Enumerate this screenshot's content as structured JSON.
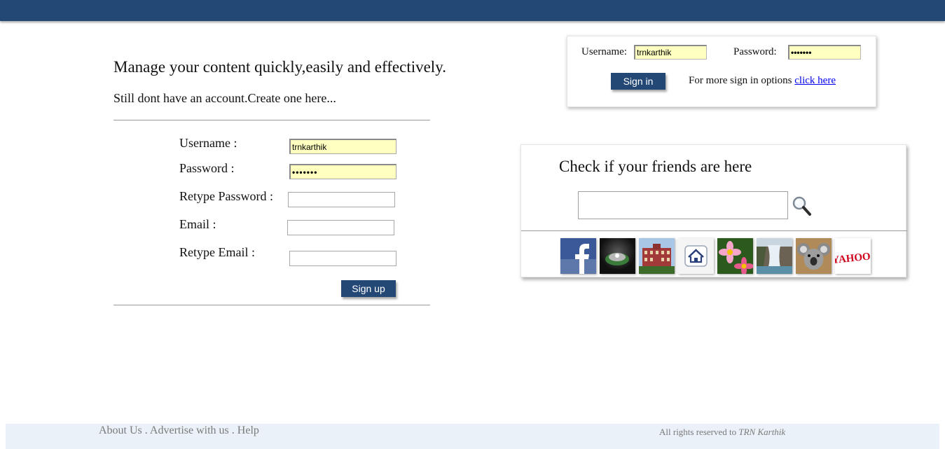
{
  "header": {
    "bar_color": "#244876"
  },
  "signup": {
    "tagline": "Manage your content quickly,easily and effectively.",
    "subline": "Still dont have an account.Create one here...",
    "username_label": "Username :",
    "username_value": "trnkarthik",
    "password_label": "Password :",
    "password_value": "•••••••",
    "retype_password_label": "Retype Password :",
    "email_label": "Email :",
    "retype_email_label": "Retype Email :",
    "submit_label": "Sign up"
  },
  "login": {
    "username_label": "Username:",
    "username_value": "trnkarthik",
    "password_label": "Password:",
    "password_value": "•••••••",
    "signin_label": "Sign in",
    "more_options_text": "For more sign in options",
    "click_here": "click here"
  },
  "friends": {
    "title": "Check if your friends are here",
    "search_value": "",
    "search_icon": "magnifier-icon",
    "apps": [
      {
        "name": "facebook",
        "label": "f"
      },
      {
        "name": "disc-photo"
      },
      {
        "name": "building-photo"
      },
      {
        "name": "home",
        "icon": "home-icon"
      },
      {
        "name": "flower-photo"
      },
      {
        "name": "waterfall-photo"
      },
      {
        "name": "koala-photo"
      },
      {
        "name": "yahoo",
        "label": "YAHOO!"
      }
    ]
  },
  "footer": {
    "about": "About Us",
    "sep1": " . ",
    "advertise": "Advertise with us",
    "sep2": " . ",
    "help": "Help",
    "copyright_prefix": "All rights reserved to ",
    "copyright_name": "TRN Karthik"
  }
}
